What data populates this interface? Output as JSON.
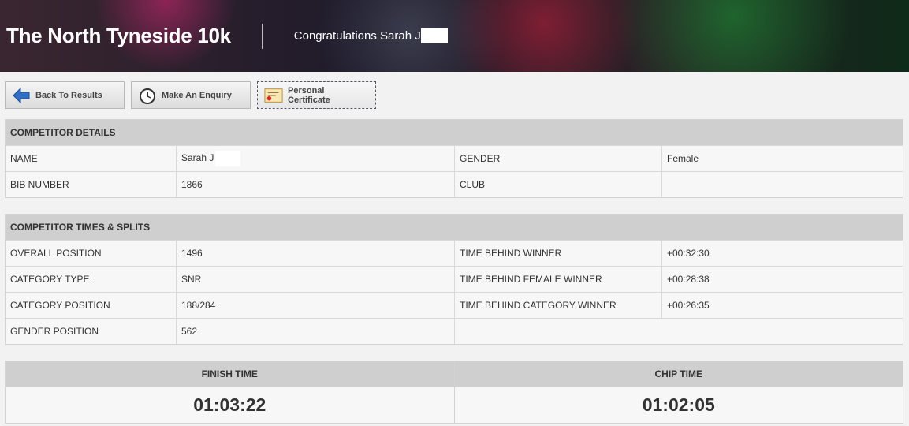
{
  "banner": {
    "title": "The North Tyneside 10k",
    "congrats": "Congratulations Sarah J"
  },
  "toolbar": {
    "back": "Back To Results",
    "enquiry": "Make An Enquiry",
    "certificate": "Personal Certificate"
  },
  "competitor": {
    "heading": "COMPETITOR DETAILS",
    "name_label": "NAME",
    "name_value": "Sarah J",
    "gender_label": "GENDER",
    "gender_value": "Female",
    "bib_label": "BIB NUMBER",
    "bib_value": "1866",
    "club_label": "CLUB",
    "club_value": ""
  },
  "splits": {
    "heading": "COMPETITOR TIMES & SPLITS",
    "rows": [
      {
        "l1": "OVERALL POSITION",
        "v1": "1496",
        "l2": "TIME BEHIND WINNER",
        "v2": "+00:32:30"
      },
      {
        "l1": "CATEGORY TYPE",
        "v1": "SNR",
        "l2": "TIME BEHIND FEMALE WINNER",
        "v2": "+00:28:38"
      },
      {
        "l1": "CATEGORY POSITION",
        "v1": "188/284",
        "l2": "TIME BEHIND CATEGORY WINNER",
        "v2": "+00:26:35"
      },
      {
        "l1": "GENDER POSITION",
        "v1": "562"
      }
    ]
  },
  "times": {
    "finish_label": "FINISH TIME",
    "finish": "01:03:22",
    "chip_label": "CHIP TIME",
    "chip": "01:02:05"
  },
  "icons": {
    "back": "left-arrow-icon",
    "enquiry": "stopwatch-icon",
    "certificate": "certificate-icon"
  }
}
